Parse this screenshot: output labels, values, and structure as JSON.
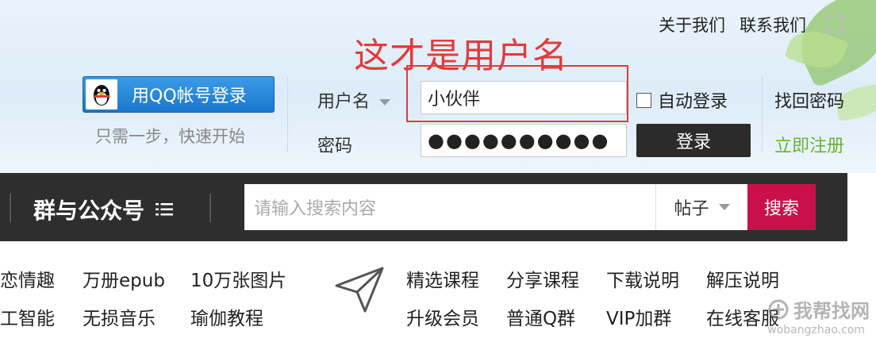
{
  "header": {
    "top_links": [
      "关于我们",
      "联系我们"
    ],
    "annotation": "这才是用户名",
    "qq_button_label": "用QQ帐号登录",
    "qq_subtext": "只需一步，快速开始",
    "username_label": "用户名",
    "username_value": "小伙伴",
    "password_label": "密码",
    "password_value": "●●●●●●●●●●",
    "auto_login_label": "自动登录",
    "login_button_label": "登录",
    "recover_password_label": "找回密码",
    "register_label": "立即注册"
  },
  "navbar": {
    "title": "群与公众号",
    "search_placeholder": "请输入搜索内容",
    "search_type": "帖子",
    "search_button_label": "搜索"
  },
  "links": {
    "row1": [
      "恋情趣",
      "万册epub",
      "10万张图片",
      "精选课程",
      "分享课程",
      "下载说明",
      "解压说明"
    ],
    "row2": [
      "工智能",
      "无损音乐",
      "瑜伽教程",
      "升级会员",
      "普通Q群",
      "VIP加群",
      "在线客服"
    ]
  },
  "watermark": {
    "text": "我帮找网",
    "url": "wobangzhao.com"
  },
  "colors": {
    "accent_red": "#c9104a",
    "register_green": "#6bb233",
    "annotation_red": "#e23b3b",
    "navbar_bg": "#2e2e2e"
  }
}
